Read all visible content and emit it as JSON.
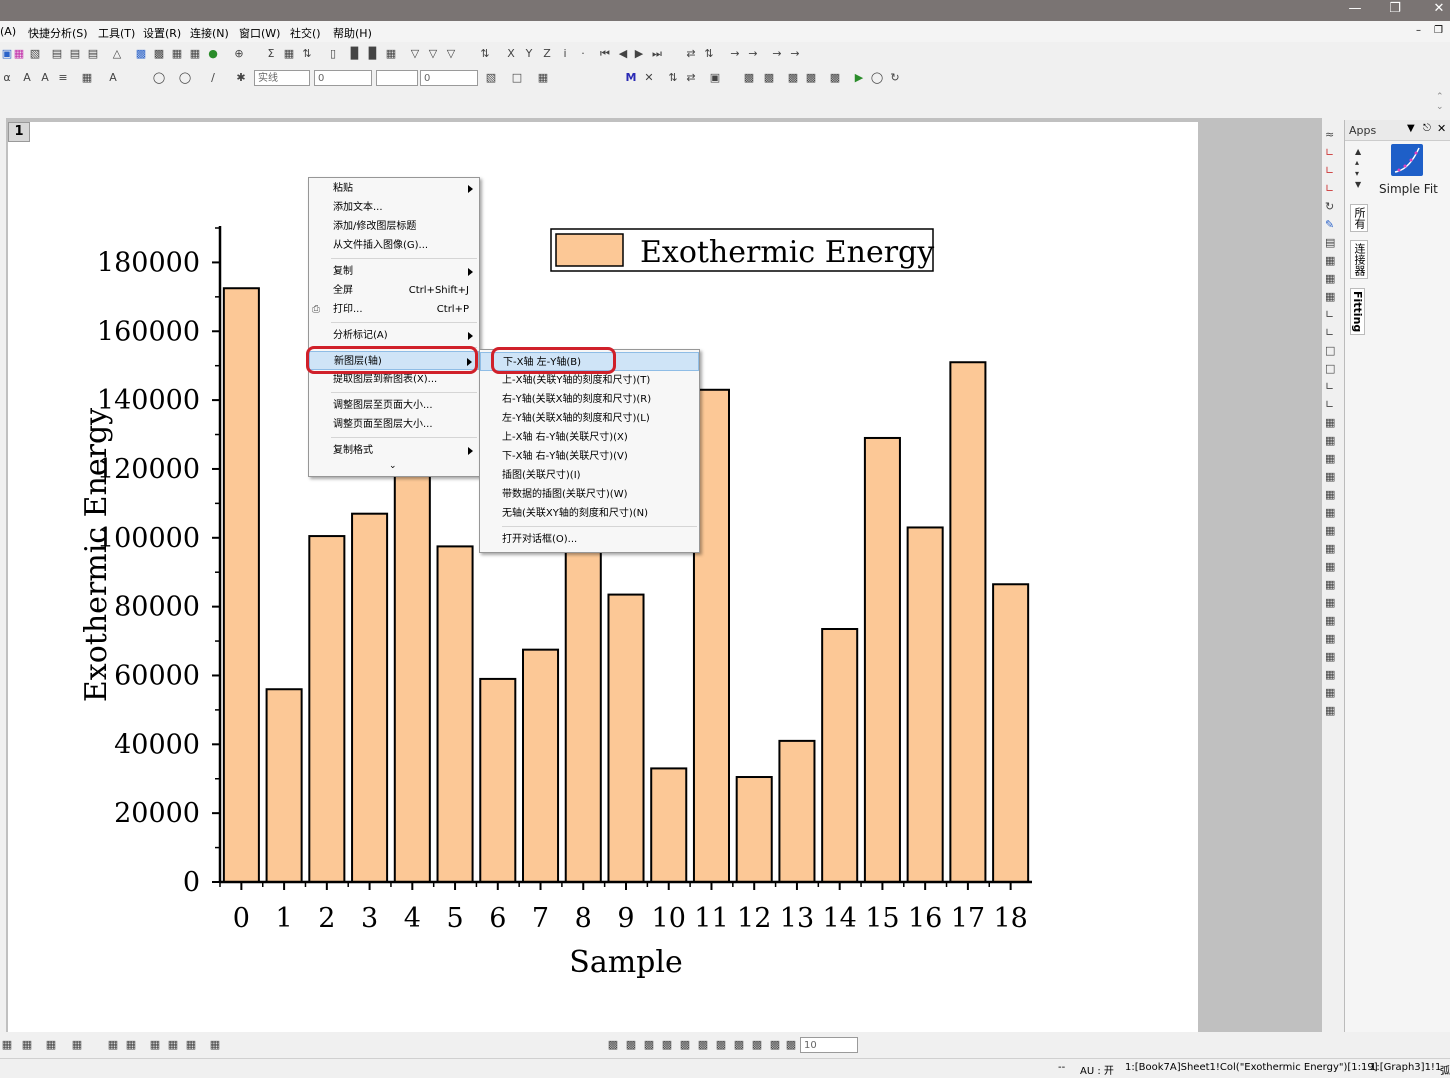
{
  "menubar": {
    "items": [
      "(A)",
      "快捷分析(S)",
      "工具(T)",
      "设置(R)",
      "连接(N)",
      "窗口(W)",
      "社交()",
      "帮助(H)"
    ]
  },
  "toolbar": {
    "line_style": "实线",
    "width1": "0",
    "width2": "0",
    "zoom": "10"
  },
  "graph": {
    "layer_number": "1",
    "chart_data": {
      "type": "bar",
      "categories": [
        "0",
        "1",
        "2",
        "3",
        "4",
        "5",
        "6",
        "7",
        "8",
        "9",
        "10",
        "11",
        "12",
        "13",
        "14",
        "15",
        "16",
        "17",
        "18"
      ],
      "values": [
        172500,
        56000,
        100500,
        107000,
        120000,
        97500,
        59000,
        67500,
        99000,
        83500,
        33000,
        143000,
        30500,
        41000,
        73500,
        129000,
        103000,
        151000,
        86500
      ],
      "xlabel": "Sample",
      "ylabel": "Exothermic Energy",
      "ylim": [
        0,
        190000
      ],
      "yticks": [
        "0",
        "20000",
        "40000",
        "60000",
        "80000",
        "100000",
        "120000",
        "140000",
        "160000",
        "180000"
      ],
      "legend": "Exothermic Energy",
      "legend_position": "top-right",
      "bar_color": "#fcc896",
      "grid": false
    }
  },
  "context_menu": {
    "items": [
      {
        "label": "粘贴",
        "shortcut": "",
        "submenu": true
      },
      {
        "label": "添加文本...",
        "shortcut": "",
        "submenu": false
      },
      {
        "label": "添加/修改图层标题",
        "shortcut": "",
        "submenu": false
      },
      {
        "label": "从文件插入图像(G)...",
        "shortcut": "",
        "submenu": false
      },
      {
        "label": "复制",
        "shortcut": "",
        "submenu": true
      },
      {
        "label": "全屏",
        "shortcut": "Ctrl+Shift+J",
        "submenu": false
      },
      {
        "label": "打印...",
        "shortcut": "Ctrl+P",
        "submenu": false
      },
      {
        "label": "分析标记(A)",
        "shortcut": "",
        "submenu": true
      },
      {
        "label": "新图层(轴)",
        "shortcut": "",
        "submenu": true
      },
      {
        "label": "提取图层到新图表(X)...",
        "shortcut": "",
        "submenu": false
      },
      {
        "label": "调整图层至页面大小...",
        "shortcut": "",
        "submenu": false
      },
      {
        "label": "调整页面至图层大小...",
        "shortcut": "",
        "submenu": false
      },
      {
        "label": "复制格式",
        "shortcut": "",
        "submenu": true
      }
    ]
  },
  "submenu": {
    "items": [
      "下-X轴 左-Y轴(B)",
      "上-X轴(关联Y轴的刻度和尺寸)(T)",
      "右-Y轴(关联X轴的刻度和尺寸)(R)",
      "左-Y轴(关联X轴的刻度和尺寸)(L)",
      "上-X轴 右-Y轴(关联尺寸)(X)",
      "下-X轴 右-Y轴(关联尺寸)(V)",
      "插图(关联尺寸)(I)",
      "带数据的插图(关联尺寸)(W)",
      "无轴(关联XY轴的刻度和尺寸)(N)",
      "打开对话框(O)..."
    ]
  },
  "side_tabs": [
    "所有",
    "连接器",
    "Fitting"
  ],
  "apps_panel": {
    "title": "Apps",
    "app_name": "Simple Fit"
  },
  "statusbar": {
    "sep": "--",
    "au": "AU : 开",
    "col": "1:[Book7A]Sheet1!Col(\"Exothermic Energy\")[1:19]",
    "graph": "1:[Graph3]1!1",
    "tail": "弧"
  }
}
